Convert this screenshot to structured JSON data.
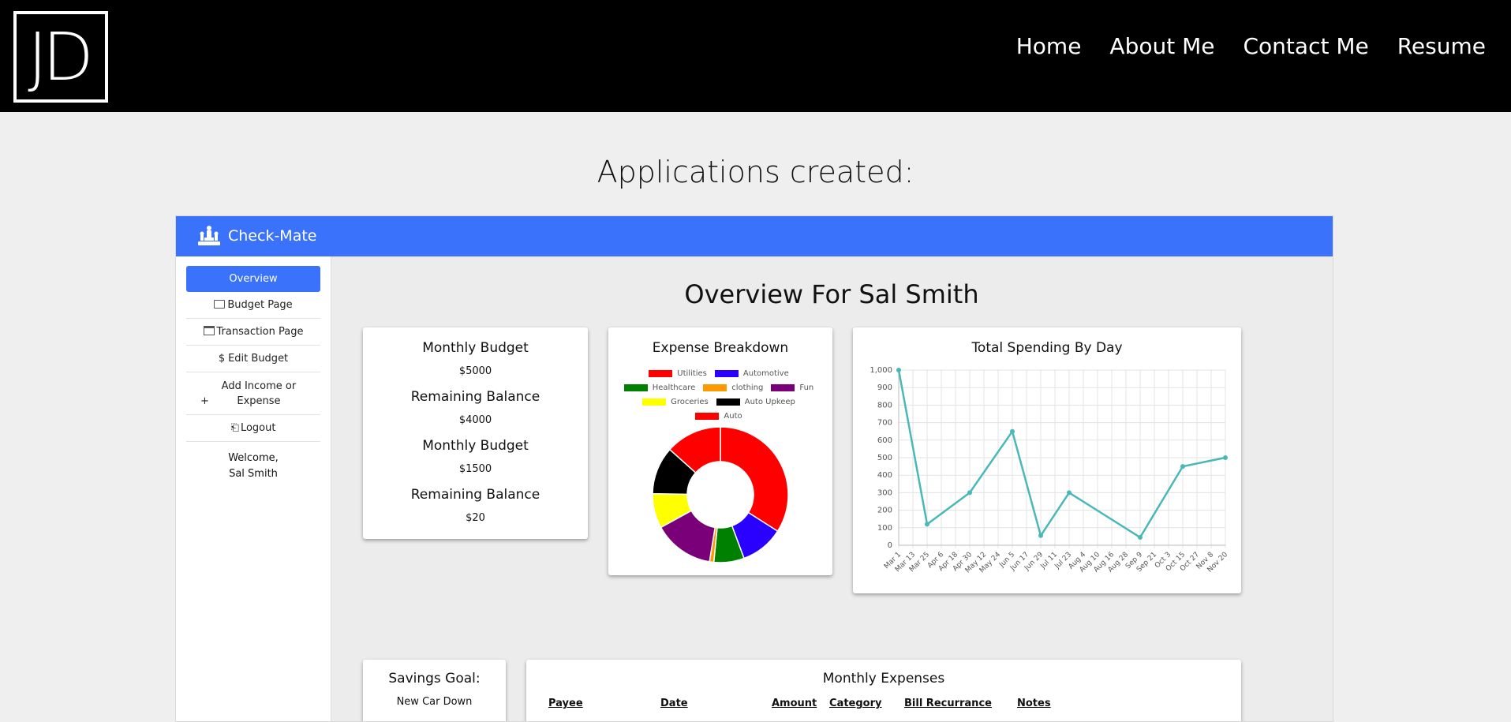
{
  "site": {
    "logo_text": "JD",
    "nav": [
      "Home",
      "About Me",
      "Contact Me",
      "Resume"
    ],
    "heading": "Applications created:"
  },
  "app": {
    "brand": "Check-Mate",
    "accent_color": "#3a72fb",
    "sidebar": {
      "items": [
        {
          "label": "Overview",
          "icon": "none",
          "active": true
        },
        {
          "label": "Budget Page",
          "icon": "folder-icon"
        },
        {
          "label": "Transaction Page",
          "icon": "card-icon"
        },
        {
          "label": "Edit Budget",
          "icon": "dollar-icon"
        },
        {
          "label": "Add Income or Expense",
          "icon": "plus-icon"
        },
        {
          "label": "Logout",
          "icon": "logout-icon"
        }
      ],
      "welcome_line1": "Welcome,",
      "welcome_line2": "Sal Smith"
    },
    "main_title": "Overview For Sal Smith",
    "budget_card": {
      "rows": [
        {
          "label": "Monthly Budget",
          "value": "$5000"
        },
        {
          "label": "Remaining Balance",
          "value": "$4000"
        },
        {
          "label": "Monthly Budget",
          "value": "$1500"
        },
        {
          "label": "Remaining Balance",
          "value": "$20"
        }
      ]
    },
    "savings_card": {
      "title": "Savings Goal:",
      "value": "New Car Down"
    },
    "expenses_card": {
      "title": "Monthly Expenses",
      "columns": [
        "Payee",
        "Date",
        "Amount",
        "Category",
        "Bill Recurrance",
        "Notes"
      ]
    }
  },
  "chart_data": [
    {
      "type": "pie",
      "title": "Expense Breakdown",
      "donut": true,
      "legend_position": "top",
      "categories": [
        "Utilities",
        "Automotive",
        "Healthcare",
        "clothing",
        "Fun",
        "Groceries",
        "Auto Upkeep",
        "Auto"
      ],
      "colors": [
        "#ff0000",
        "#2a00ff",
        "#008000",
        "#ff9900",
        "#7a007a",
        "#ffff00",
        "#000000",
        "#ff0000"
      ],
      "values": [
        33,
        10,
        7,
        1,
        14,
        8,
        11,
        13
      ]
    },
    {
      "type": "line",
      "title": "Total Spending By Day",
      "grid": true,
      "color": "#4ab8b8",
      "x": [
        "Mar 1",
        "Mar 13",
        "Mar 25",
        "Apr 6",
        "Apr 18",
        "Apr 30",
        "May 12",
        "May 24",
        "Jun 5",
        "Jun 17",
        "Jun 29",
        "Jul 11",
        "Jul 23",
        "Aug 4",
        "Aug 10",
        "Aug 16",
        "Aug 28",
        "Sep 9",
        "Sep 21",
        "Oct 3",
        "Oct 15",
        "Oct 27",
        "Nov 8",
        "Nov 20"
      ],
      "points": [
        {
          "x": "Mar 1",
          "y": 1000
        },
        {
          "x": "Mar 25",
          "y": 120
        },
        {
          "x": "Apr 30",
          "y": 300
        },
        {
          "x": "Jun 5",
          "y": 650
        },
        {
          "x": "Jun 29",
          "y": 55
        },
        {
          "x": "Jul 23",
          "y": 300
        },
        {
          "x": "Sep 9",
          "y": 45
        },
        {
          "x": "Oct 15",
          "y": 450
        },
        {
          "x": "Nov 20",
          "y": 500
        }
      ],
      "yticks": [
        "0",
        "100",
        "200",
        "300",
        "400",
        "500",
        "600",
        "700",
        "800",
        "900",
        "1,000"
      ],
      "ylim": [
        0,
        1000
      ]
    }
  ]
}
